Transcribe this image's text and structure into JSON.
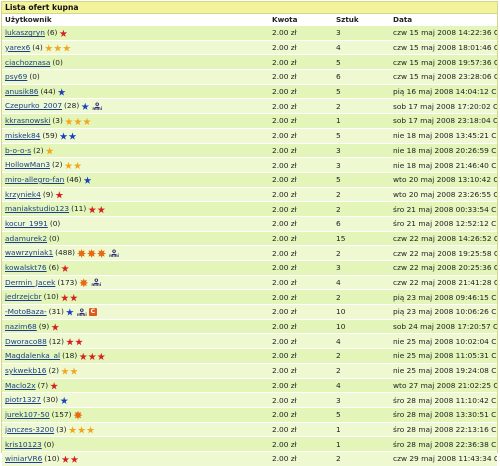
{
  "panel": {
    "title": "Lista ofert kupna"
  },
  "columns": {
    "user": "Użytkownik",
    "kwota": "Kwota",
    "sztuk": "Sztuk",
    "data": "Data"
  },
  "badges": {
    "mini_label": "mini",
    "c_label": "C"
  },
  "rows": [
    {
      "login": "lukaszgryn",
      "count": "(6)",
      "icons": [
        "red"
      ],
      "kwota": "2.00 zł",
      "sztuk": "3",
      "data": "czw 15 maj 2008 14:22:36 CEST"
    },
    {
      "login": "yarex6",
      "count": "(4)",
      "icons": [
        "yellow",
        "yellow",
        "yellow"
      ],
      "kwota": "2.00 zł",
      "sztuk": "4",
      "data": "czw 15 maj 2008 18:01:46 CEST"
    },
    {
      "login": "ciachoznasa",
      "count": "(0)",
      "icons": [],
      "kwota": "2.00 zł",
      "sztuk": "5",
      "data": "czw 15 maj 2008 19:57:36 CEST"
    },
    {
      "login": "psy69",
      "count": "(0)",
      "icons": [],
      "kwota": "2.00 zł",
      "sztuk": "6",
      "data": "czw 15 maj 2008 23:28:06 CEST"
    },
    {
      "login": "anusik86",
      "count": "(44)",
      "icons": [
        "blue"
      ],
      "kwota": "2.00 zł",
      "sztuk": "5",
      "data": "pią 16 maj 2008 14:04:12 CEST"
    },
    {
      "login": "Czepurko_2007",
      "count": "(28)",
      "icons": [
        "blue",
        "mini"
      ],
      "kwota": "2.00 zł",
      "sztuk": "2",
      "data": "sob 17 maj 2008 17:20:02 CEST"
    },
    {
      "login": "kkrasnowski",
      "count": "(3)",
      "icons": [
        "yellow",
        "yellow",
        "yellow"
      ],
      "kwota": "2.00 zł",
      "sztuk": "1",
      "data": "sob 17 maj 2008 23:18:04 CEST"
    },
    {
      "login": "miskek84",
      "count": "(59)",
      "icons": [
        "blue",
        "blue"
      ],
      "kwota": "2.00 zł",
      "sztuk": "5",
      "data": "nie 18 maj 2008 13:45:21 CEST"
    },
    {
      "login": "b-o-o-s",
      "count": "(2)",
      "icons": [
        "yellow"
      ],
      "kwota": "2.00 zł",
      "sztuk": "3",
      "data": "nie 18 maj 2008 20:26:59 CEST"
    },
    {
      "login": "HollowMan3",
      "count": "(2)",
      "icons": [
        "yellow",
        "yellow"
      ],
      "kwota": "2.00 zł",
      "sztuk": "3",
      "data": "nie 18 maj 2008 21:46:40 CEST"
    },
    {
      "login": "miro-allegro-fan",
      "count": "(46)",
      "icons": [
        "blue"
      ],
      "kwota": "2.00 zł",
      "sztuk": "5",
      "data": "wto 20 maj 2008 13:10:42 CEST"
    },
    {
      "login": "krzyniek4",
      "count": "(9)",
      "icons": [
        "red"
      ],
      "kwota": "2.00 zł",
      "sztuk": "2",
      "data": "wto 20 maj 2008 23:26:55 CEST"
    },
    {
      "login": "maniakstudio123",
      "count": "(11)",
      "icons": [
        "red",
        "red"
      ],
      "kwota": "2.00 zł",
      "sztuk": "2",
      "data": "śro 21 maj 2008 00:33:54 CEST"
    },
    {
      "login": "kocur_1991",
      "count": "(0)",
      "icons": [],
      "kwota": "2.00 zł",
      "sztuk": "6",
      "data": "śro 21 maj 2008 12:52:12 CEST"
    },
    {
      "login": "adamurek2",
      "count": "(0)",
      "icons": [],
      "kwota": "2.00 zł",
      "sztuk": "15",
      "data": "czw 22 maj 2008 14:26:52 CEST"
    },
    {
      "login": "wawrzyniak1",
      "count": "(488)",
      "icons": [
        "sun",
        "sun",
        "sun",
        "mini"
      ],
      "kwota": "2.00 zł",
      "sztuk": "2",
      "data": "czw 22 maj 2008 19:25:58 CEST"
    },
    {
      "login": "kowalskt76",
      "count": "(6)",
      "icons": [
        "red"
      ],
      "kwota": "2.00 zł",
      "sztuk": "3",
      "data": "czw 22 maj 2008 20:25:36 CEST"
    },
    {
      "login": "Dermin_Jacek",
      "count": "(173)",
      "icons": [
        "sun",
        "mini"
      ],
      "kwota": "2.00 zł",
      "sztuk": "4",
      "data": "czw 22 maj 2008 21:41:28 CEST"
    },
    {
      "login": "jedrzejcbr",
      "count": "(10)",
      "icons": [
        "red",
        "red"
      ],
      "kwota": "2.00 zł",
      "sztuk": "2",
      "data": "pią 23 maj 2008 09:46:15 CEST"
    },
    {
      "login": "-MotoBaza-",
      "count": "(31)",
      "icons": [
        "blue",
        "mini",
        "c"
      ],
      "kwota": "2.00 zł",
      "sztuk": "10",
      "data": "pią 23 maj 2008 10:06:26 CEST"
    },
    {
      "login": "nazim68",
      "count": "(9)",
      "icons": [
        "red"
      ],
      "kwota": "2.00 zł",
      "sztuk": "10",
      "data": "sob 24 maj 2008 17:20:57 CEST"
    },
    {
      "login": "Dworaco88",
      "count": "(12)",
      "icons": [
        "red",
        "red"
      ],
      "kwota": "2.00 zł",
      "sztuk": "4",
      "data": "nie 25 maj 2008 10:02:04 CEST"
    },
    {
      "login": "Magdalenka_al",
      "count": "(18)",
      "icons": [
        "red",
        "red",
        "red"
      ],
      "kwota": "2.00 zł",
      "sztuk": "2",
      "data": "nie 25 maj 2008 11:05:31 CEST"
    },
    {
      "login": "sykwekb16",
      "count": "(2)",
      "icons": [
        "yellow",
        "yellow"
      ],
      "kwota": "2.00 zł",
      "sztuk": "2",
      "data": "nie 25 maj 2008 19:24:08 CEST"
    },
    {
      "login": "Maclo2x",
      "count": "(7)",
      "icons": [
        "red"
      ],
      "kwota": "2.00 zł",
      "sztuk": "4",
      "data": "wto 27 maj 2008 21:02:25 CEST"
    },
    {
      "login": "piotr1327",
      "count": "(30)",
      "icons": [
        "blue"
      ],
      "kwota": "2.00 zł",
      "sztuk": "3",
      "data": "śro 28 maj 2008 11:10:42 CEST"
    },
    {
      "login": "jurek107-50",
      "count": "(157)",
      "icons": [
        "sun"
      ],
      "kwota": "2.00 zł",
      "sztuk": "5",
      "data": "śro 28 maj 2008 13:30:51 CEST"
    },
    {
      "login": "janczes-3200",
      "count": "(3)",
      "icons": [
        "yellow",
        "yellow",
        "yellow"
      ],
      "kwota": "2.00 zł",
      "sztuk": "1",
      "data": "śro 28 maj 2008 22:13:16 CEST"
    },
    {
      "login": "kris10123",
      "count": "(0)",
      "icons": [],
      "kwota": "2.00 zł",
      "sztuk": "1",
      "data": "śro 28 maj 2008 22:36:38 CEST"
    },
    {
      "login": "winiarVR6",
      "count": "(10)",
      "icons": [
        "red",
        "red"
      ],
      "kwota": "2.00 zł",
      "sztuk": "2",
      "data": "czw 29 maj 2008 11:43:34 CEST"
    }
  ]
}
